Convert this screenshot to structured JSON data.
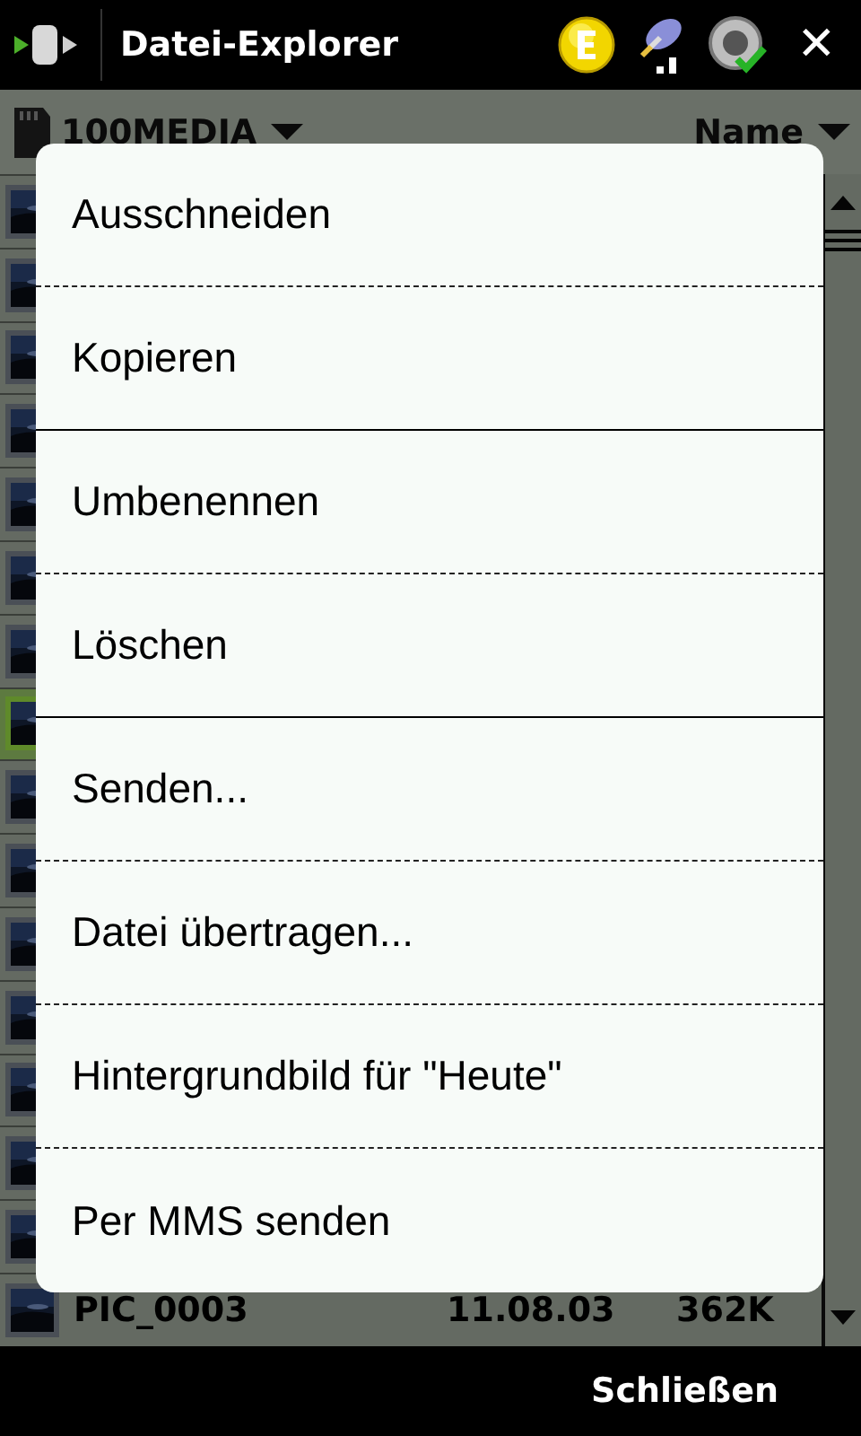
{
  "title_bar": {
    "title": "Datei-Explorer",
    "close": "✕"
  },
  "header": {
    "folder": "100MEDIA",
    "sort": "Name"
  },
  "files": [
    {
      "selected": false
    },
    {
      "selected": false
    },
    {
      "selected": false
    },
    {
      "selected": false
    },
    {
      "selected": false
    },
    {
      "selected": false
    },
    {
      "selected": false
    },
    {
      "selected": true
    },
    {
      "selected": false
    },
    {
      "selected": false
    },
    {
      "selected": false
    },
    {
      "selected": false
    },
    {
      "selected": false
    },
    {
      "selected": false
    },
    {
      "selected": false
    },
    {
      "selected": false,
      "name": "PIC_0003",
      "date": "11.08.03",
      "size": "362K"
    }
  ],
  "menu": [
    {
      "label": "Ausschneiden",
      "group_end": false
    },
    {
      "label": "Kopieren",
      "group_end": true
    },
    {
      "label": "Umbenennen",
      "group_end": false
    },
    {
      "label": "Löschen",
      "group_end": true
    },
    {
      "label": "Senden...",
      "group_end": false
    },
    {
      "label": "Datei übertragen...",
      "group_end": false
    },
    {
      "label": "Hintergrundbild für \"Heute\"",
      "group_end": false
    },
    {
      "label": "Per MMS senden"
    }
  ],
  "softkey": "Schließen"
}
